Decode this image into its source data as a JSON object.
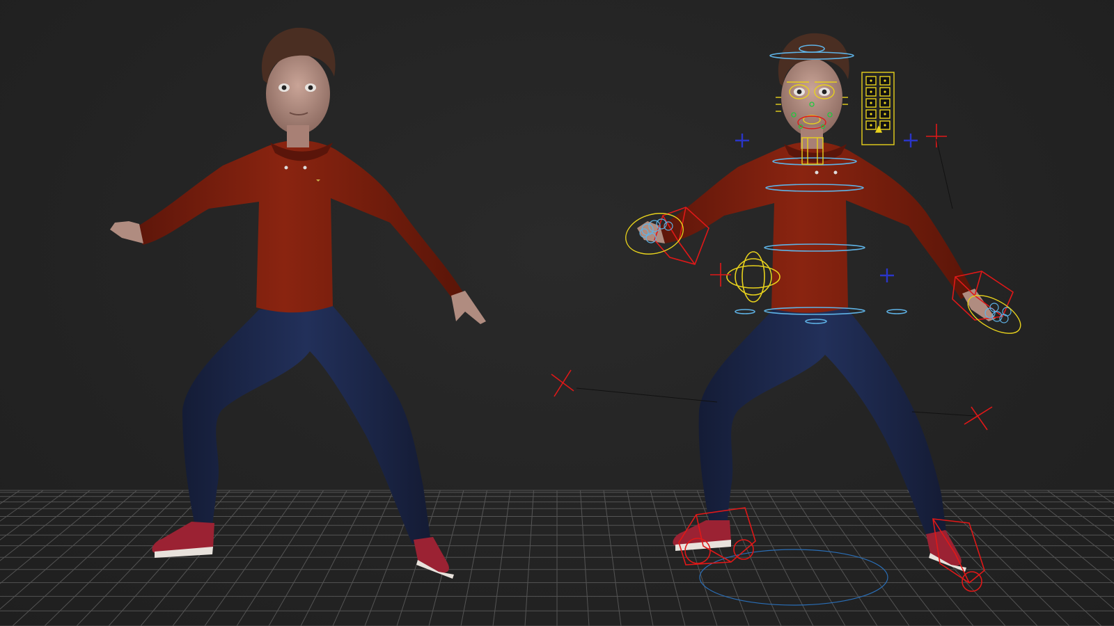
{
  "scene": {
    "background_color": "#232323",
    "grid_color": "#8a8a8a",
    "characters": [
      {
        "name": "posed-character-unrigged",
        "shirt_color": "#7e1f0f",
        "pants_color": "#1c2647",
        "skin_color": "#b08c80",
        "hair_color": "#4a2e22",
        "shoe_color": "#9b2233"
      },
      {
        "name": "posed-character-with-rig-controls",
        "shirt_color": "#7e1f0f",
        "pants_color": "#1c2647",
        "skin_color": "#b08c80",
        "hair_color": "#4a2e22",
        "shoe_color": "#9b2233"
      }
    ],
    "rig_control_colors": {
      "ik": "#e01818",
      "fk": "#5fb3e6",
      "face": "#e8d21c",
      "pivot": "#2a35c8",
      "face_detail": "#20c840"
    }
  }
}
